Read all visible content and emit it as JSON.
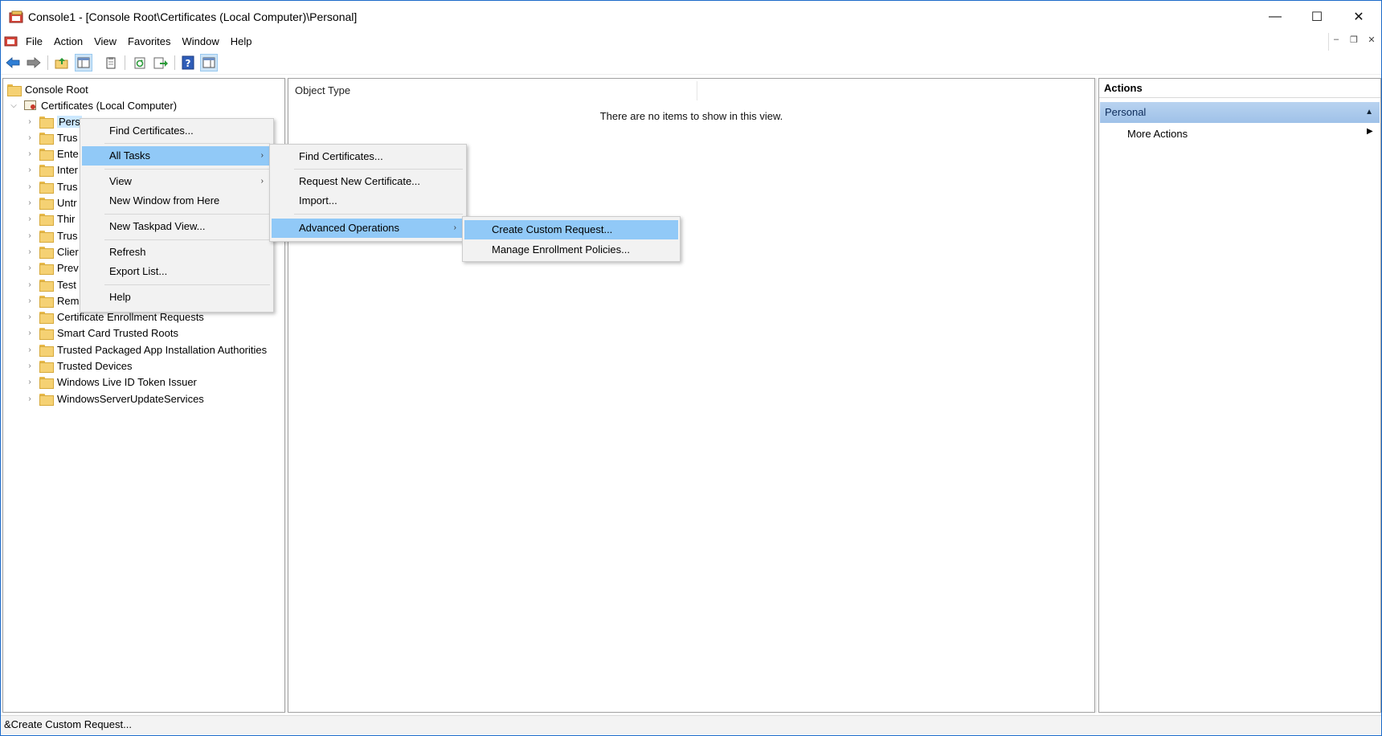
{
  "window": {
    "title": "Console1 - [Console Root\\Certificates (Local Computer)\\Personal]",
    "min_glyph": "—",
    "max_glyph": "☐",
    "close_glyph": "✕"
  },
  "menubar": {
    "items": [
      "File",
      "Action",
      "View",
      "Favorites",
      "Window",
      "Help"
    ],
    "mdi": [
      "–",
      "❐",
      "✕"
    ]
  },
  "toolbar": {
    "buttons": [
      "back-icon",
      "forward-icon",
      "up-folder-icon",
      "show-hide-tree-icon",
      "clipboard-icon",
      "refresh-icon",
      "export-icon",
      "help-icon",
      "show-hide-action-pane-icon"
    ]
  },
  "tree": {
    "root": "Console Root",
    "store": "Certificates (Local Computer)",
    "children": [
      "Pers",
      "Trus",
      "Ente",
      "Inter",
      "Trus",
      "Untr",
      "Thir",
      "Trus",
      "Clier",
      "Prev",
      "Test",
      "Rem",
      "Certificate Enrollment Requests",
      "Smart Card Trusted Roots",
      "Trusted Packaged App Installation Authorities",
      "Trusted Devices",
      "Windows Live ID Token Issuer",
      "WindowsServerUpdateServices"
    ],
    "selected_index": 0
  },
  "list": {
    "column": "Object Type",
    "empty_message": "There are no items to show in this view."
  },
  "actions": {
    "header": "Actions",
    "section": "Personal",
    "items": [
      "More Actions"
    ]
  },
  "context_menu": {
    "find": "Find Certificates...",
    "all_tasks": "All Tasks",
    "view": "View",
    "new_window": "New Window from Here",
    "new_taskpad": "New Taskpad View...",
    "refresh": "Refresh",
    "export": "Export List...",
    "help": "Help"
  },
  "all_tasks_menu": {
    "find": "Find Certificates...",
    "request": "Request New Certificate...",
    "import": "Import...",
    "advanced": "Advanced Operations"
  },
  "advanced_menu": {
    "create_custom": "Create Custom Request...",
    "manage_policies": "Manage Enrollment Policies..."
  },
  "status": {
    "text": "&Create Custom Request..."
  }
}
